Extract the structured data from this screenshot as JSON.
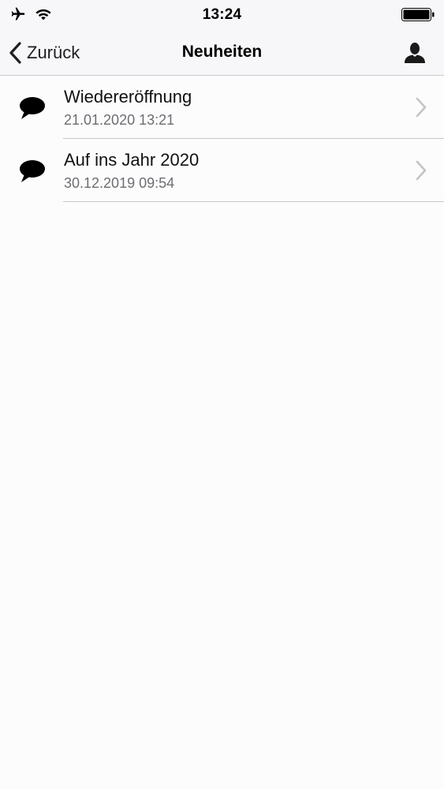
{
  "status_bar": {
    "time": "13:24",
    "icons": [
      "airplane-icon",
      "wifi-icon",
      "battery-icon"
    ]
  },
  "nav": {
    "back_label": "Zurück",
    "title": "Neuheiten",
    "right_icon": "person-icon"
  },
  "news": [
    {
      "title": "Wiedereröffnung",
      "date": "21.01.2020 13:21",
      "icon": "speech-bubble-icon"
    },
    {
      "title": "Auf ins Jahr 2020",
      "date": "30.12.2019 09:54",
      "icon": "speech-bubble-icon"
    }
  ],
  "colors": {
    "bar_background": "#f7f6f8",
    "page_background": "#fdfcfd",
    "separator": "#c8c7cc",
    "secondary_text": "#6d6d72",
    "chevron": "#c4c4c7"
  }
}
